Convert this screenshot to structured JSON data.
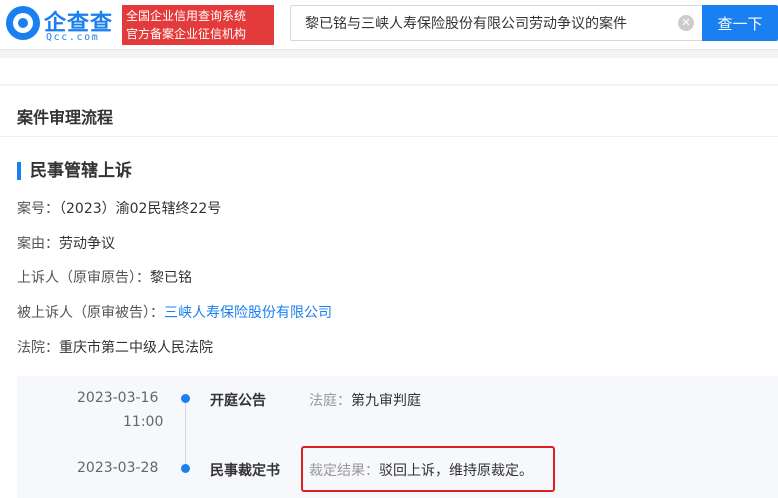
{
  "header": {
    "logo_name": "企查查",
    "logo_domain": "Qcc.com",
    "slogan_line1": "全国企业信用查询系统",
    "slogan_line2": "官方备案企业征信机构",
    "search_value": "黎已铭与三峡人寿保险股份有限公司劳动争议的案件",
    "search_button": "查一下",
    "clear_symbol": "✕"
  },
  "section": {
    "title": "案件审理流程",
    "sub_title": "民事管辖上诉"
  },
  "fields": [
    {
      "label": "案号：",
      "value": "（2023）渝02民辖终22号"
    },
    {
      "label": "案由：",
      "value": "劳动争议"
    },
    {
      "label": "上诉人（原审原告）：",
      "value": "黎已铭"
    },
    {
      "label": "被上诉人（原审被告）：",
      "value": "三峡人寿保险股份有限公司"
    },
    {
      "label": "法院：",
      "value": "重庆市第二中级人民法院"
    }
  ],
  "timeline": [
    {
      "date": "2023-03-16",
      "time": "11:00",
      "name": "开庭公告",
      "detail_label": "法庭：",
      "detail_value": "第九审判庭"
    },
    {
      "date": "2023-03-28",
      "time": "",
      "name": "民事裁定书",
      "detail_label": "裁定结果：",
      "detail_value": "驳回上诉，维持原裁定。"
    }
  ],
  "colors": {
    "brand": "#1a7ff0",
    "slogan_bg": "#e33b3b",
    "highlight": "#e02020"
  }
}
